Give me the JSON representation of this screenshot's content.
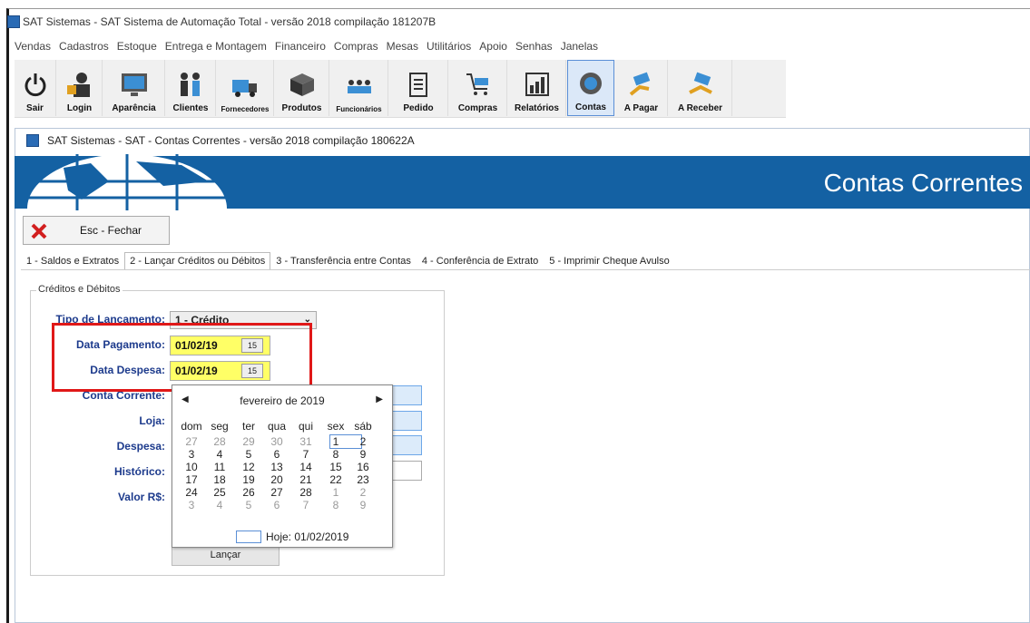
{
  "app": {
    "title": "SAT Sistemas - SAT Sistema de Automação Total - versão 2018 compilação 181207B"
  },
  "menu": [
    "Vendas",
    "Cadastros",
    "Estoque",
    "Entrega e Montagem",
    "Financeiro",
    "Compras",
    "Mesas",
    "Utilitários",
    "Apoio",
    "Senhas",
    "Janelas"
  ],
  "toolbar": [
    "Sair",
    "Login",
    "Aparência",
    "Clientes",
    "Fornecedores",
    "Produtos",
    "Funcionários",
    "Pedido",
    "Compras",
    "Relatórios",
    "Contas",
    "A Pagar",
    "A Receber"
  ],
  "child": {
    "title": "SAT Sistemas - SAT - Contas Correntes - versão 2018 compilação 180622A",
    "banner": "Contas Correntes",
    "close": "Esc - Fechar"
  },
  "tabs": [
    "1 - Saldos e Extratos",
    "2 - Lançar Créditos ou Débitos",
    "3 - Transferência entre Contas",
    "4 - Conferência de Extrato",
    "5 - Imprimir Cheque Avulso"
  ],
  "form": {
    "group_title": "Créditos e Débitos",
    "tipo_label": "Tipo de Lançamento:",
    "tipo_value": "1 - Crédito",
    "data_pag_label": "Data Pagamento:",
    "data_pag_value": "01/02/19",
    "data_desp_label": "Data Despesa:",
    "data_desp_value": "01/02/19",
    "conta_label": "Conta Corrente:",
    "loja_label": "Loja:",
    "despesa_label": "Despesa:",
    "historico_label": "Histórico:",
    "valor_label": "Valor R$:",
    "lancar": "Lançar",
    "cal_btn": "15"
  },
  "calendar": {
    "header": "fevereiro de 2019",
    "dow": [
      "dom",
      "seg",
      "ter",
      "qua",
      "qui",
      "sex",
      "sáb"
    ],
    "weeks": [
      [
        "27",
        "28",
        "29",
        "30",
        "31",
        "1",
        "2"
      ],
      [
        "3",
        "4",
        "5",
        "6",
        "7",
        "8",
        "9"
      ],
      [
        "10",
        "11",
        "12",
        "13",
        "14",
        "15",
        "16"
      ],
      [
        "17",
        "18",
        "19",
        "20",
        "21",
        "22",
        "23"
      ],
      [
        "24",
        "25",
        "26",
        "27",
        "28",
        "1",
        "2"
      ],
      [
        "3",
        "4",
        "5",
        "6",
        "7",
        "8",
        "9"
      ]
    ],
    "today": "Hoje: 01/02/2019"
  },
  "colors": {
    "banner": "#1461a3",
    "highlight": "#e01818",
    "field_yellow": "#ffff66",
    "label_blue": "#1c3a8c"
  }
}
